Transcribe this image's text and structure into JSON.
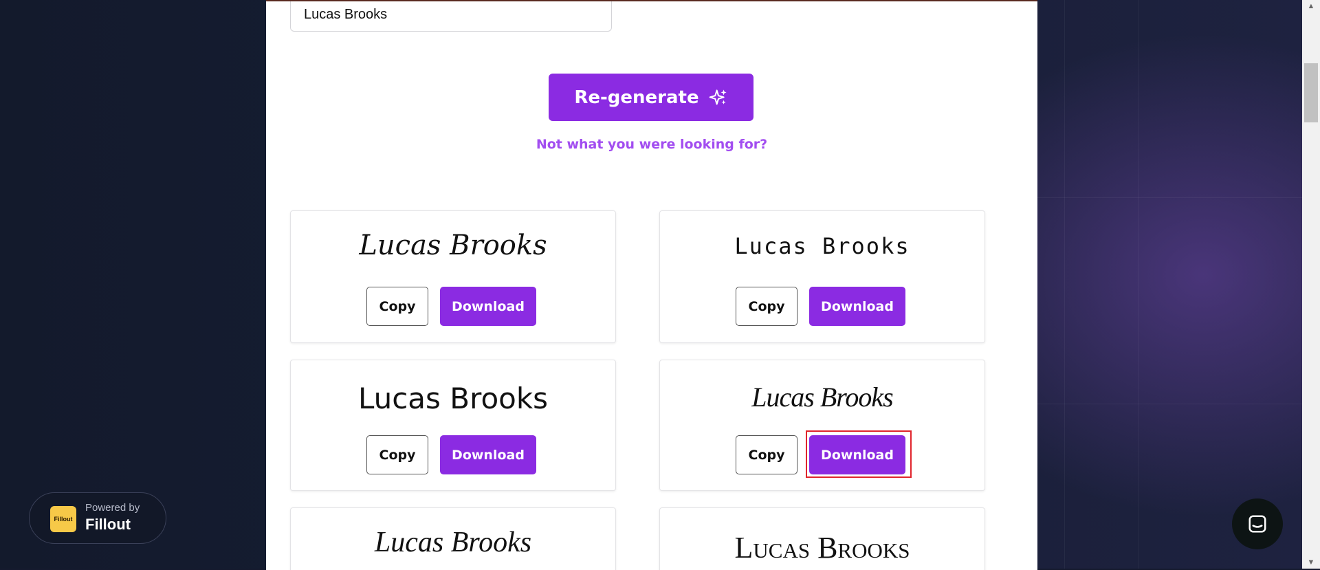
{
  "form": {
    "name_value": "Lucas Brooks",
    "regenerate_label": "Re-generate",
    "not_looking_label": "Not what you were looking for?"
  },
  "signatures": [
    {
      "text": "Lucas Brooks",
      "copy_label": "Copy",
      "download_label": "Download"
    },
    {
      "text": "Lucas Brooks",
      "copy_label": "Copy",
      "download_label": "Download"
    },
    {
      "text": "Lucas Brooks",
      "copy_label": "Copy",
      "download_label": "Download"
    },
    {
      "text": "Lucas Brooks",
      "copy_label": "Copy",
      "download_label": "Download"
    },
    {
      "text": "Lucas Brooks"
    },
    {
      "text": "Lucas Brooks"
    }
  ],
  "badge": {
    "powered_by": "Powered by",
    "brand": "Fillout",
    "logo_text": "Fillout"
  },
  "colors": {
    "accent": "#8b2be2",
    "hint": "#a24df0",
    "highlight": "#e0242c"
  }
}
